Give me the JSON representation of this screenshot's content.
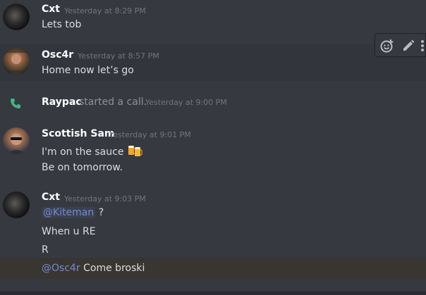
{
  "messages": [
    {
      "author": "Cxt",
      "timestamp": "Yesterday at 8:29 PM",
      "lines": [
        "Lets tob"
      ]
    },
    {
      "author": "Osc4r",
      "timestamp": "Yesterday at 8:57 PM",
      "lines": [
        "Home now let’s go"
      ]
    },
    {
      "system": true,
      "author": "Raypac",
      "action": "started a call.",
      "timestamp": "Yesterday at 9:00 PM"
    },
    {
      "author": "Scottish Sam",
      "timestamp": "Yesterday at 9:01 PM",
      "lines": [
        "I'm on the sauce",
        "Be on tomorrow."
      ],
      "emoji": "beers"
    },
    {
      "author": "Cxt",
      "timestamp": "Yesterday at 9:03 PM",
      "mention1": "@Kiteman",
      "mention1_suffix": " ?",
      "line2": "When u RE",
      "line3": "R",
      "mention2": "@Osc4r",
      "mention2_suffix": " Come broski"
    }
  ],
  "toolbar": {
    "icons": [
      "add-reaction-icon",
      "edit-icon",
      "more-icon"
    ]
  },
  "colors": {
    "background": "#36393f",
    "mention": "#7289da",
    "call_green": "#43b581",
    "timestamp": "#72767d"
  }
}
